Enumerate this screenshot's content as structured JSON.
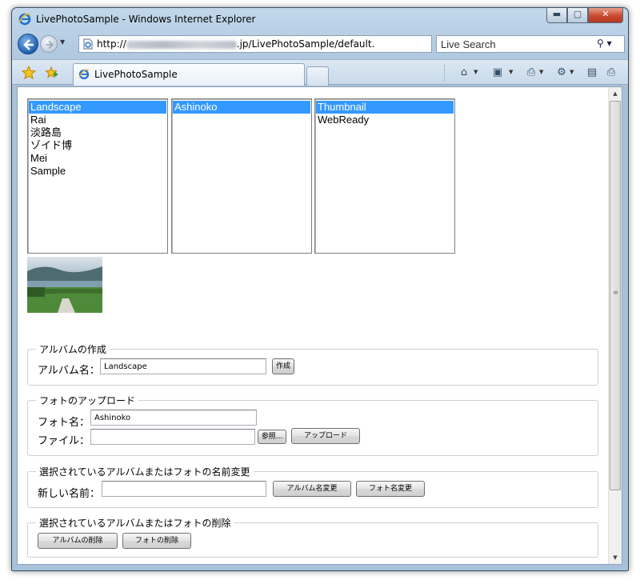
{
  "window": {
    "title": "LivePhotoSample - Windows Internet Explorer",
    "min_glyph": "▬",
    "max_glyph": "▢",
    "close_glyph": "✕"
  },
  "address_bar": {
    "url_prefix": "http://",
    "url_suffix": ".jp/LivePhotoSample/default.",
    "search_placeholder": "Live Search",
    "dropdown_glyph": "▼",
    "refresh_glyph": "↻",
    "stop_glyph": "✕",
    "search_glyph": "⚲ ▾"
  },
  "tabs": {
    "active_label": "LivePhotoSample"
  },
  "commands": {
    "home_glyph": "⌂",
    "feeds_glyph": "▣",
    "print_glyph": "⎙",
    "page_glyph": "▤",
    "tools_glyph": "⚙",
    "dropdown_glyph": "▼"
  },
  "lists": {
    "albums": [
      {
        "label": "Landscape",
        "selected": true
      },
      {
        "label": "Rai",
        "selected": false
      },
      {
        "label": "淡路島",
        "selected": false
      },
      {
        "label": "ゾイド博",
        "selected": false
      },
      {
        "label": "Mei",
        "selected": false
      },
      {
        "label": "Sample",
        "selected": false
      }
    ],
    "photos": [
      {
        "label": "Ashinoko",
        "selected": true
      }
    ],
    "sizes": [
      {
        "label": "Thumbnail",
        "selected": true
      },
      {
        "label": "WebReady",
        "selected": false
      }
    ]
  },
  "create_album": {
    "legend": "アルバムの作成",
    "name_label": "アルバム名：",
    "name_value": "Landscape",
    "create_button": "作成"
  },
  "upload_photo": {
    "legend": "フォトのアップロード",
    "photo_name_label": "フォト名：",
    "photo_name_value": "Ashinoko",
    "file_label": "ファイル：",
    "file_value": "",
    "browse_button": "参照...",
    "upload_button": "アップロード"
  },
  "rename": {
    "legend": "選択されているアルバムまたはフォトの名前変更",
    "new_name_label": "新しい名前：",
    "new_name_value": "",
    "rename_album_button": "アルバム名変更",
    "rename_photo_button": "フォト名変更"
  },
  "delete": {
    "legend": "選択されているアルバムまたはフォトの削除",
    "delete_album_button": "アルバムの削除",
    "delete_photo_button": "フォトの削除"
  },
  "scrollbar": {
    "up_glyph": "▲",
    "down_glyph": "▼",
    "grip_glyph": "≡"
  }
}
